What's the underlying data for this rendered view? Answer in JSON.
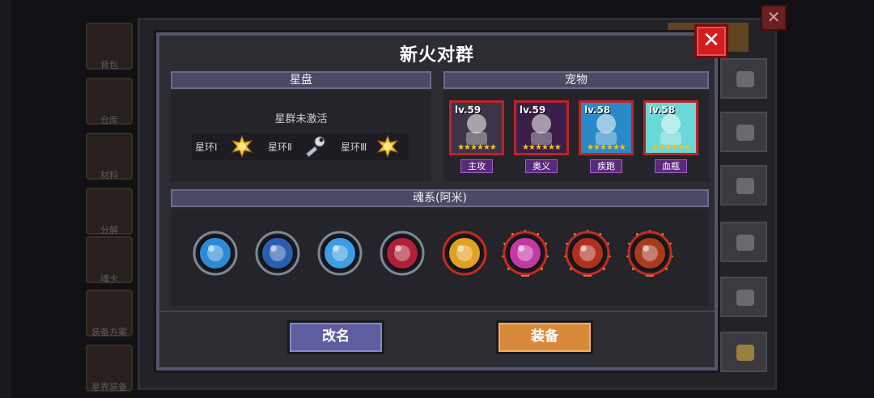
{
  "background": {
    "sidebar": [
      "背包",
      "仓库",
      "材料",
      "分解",
      "魂卡",
      "装备方案",
      "星界装备"
    ],
    "close_symbol": "✕"
  },
  "dialog": {
    "title": "新火对群",
    "close_symbol": "✕",
    "starplate": {
      "header": "星盘",
      "status": "星群未激活",
      "rings": [
        {
          "label": "星环Ⅰ",
          "icon": "sun-icon"
        },
        {
          "label": "星环Ⅱ",
          "icon": "wrench-icon"
        },
        {
          "label": "星环Ⅲ",
          "icon": "sun-icon"
        }
      ]
    },
    "pets": {
      "header": "宠物",
      "items": [
        {
          "level": "lv.59",
          "tag": "主攻",
          "stars": "★★★★★★",
          "color": "#3c3448"
        },
        {
          "level": "lv.59",
          "tag": "奥义",
          "stars": "★★★★★★",
          "color": "#3a1f4a"
        },
        {
          "level": "lv.58",
          "tag": "疾跑",
          "stars": "★★★★★★",
          "color": "#2a8ac8"
        },
        {
          "level": "lv.58",
          "tag": "血瓶",
          "stars": "★★★★★★",
          "color": "#68d8d8"
        }
      ]
    },
    "soul": {
      "header": "魂系(阿米)",
      "orbs": [
        {
          "icon": "book-icon",
          "ring": "#7d8a95",
          "core": "#2f8ad6",
          "fire": false
        },
        {
          "icon": "shield-icon",
          "ring": "#7d8a95",
          "core": "#2a5fb0",
          "fire": false
        },
        {
          "icon": "crystal-icon",
          "ring": "#7d8a95",
          "core": "#3d9de0",
          "fire": false
        },
        {
          "icon": "demon-icon",
          "ring": "#7d8a95",
          "core": "#b0203a",
          "fire": false
        },
        {
          "icon": "coin-icon",
          "ring": "#c82a22",
          "core": "#e0a020",
          "fire": false
        },
        {
          "icon": "heart-icon",
          "ring": "#c82a22",
          "core": "#c03aa0",
          "fire": true
        },
        {
          "icon": "dragon-icon",
          "ring": "#c82a22",
          "core": "#b03020",
          "fire": true
        },
        {
          "icon": "rune-icon",
          "ring": "#c82a22",
          "core": "#a83a20",
          "fire": true
        }
      ]
    },
    "buttons": {
      "rename": "改名",
      "equip": "装备"
    }
  }
}
